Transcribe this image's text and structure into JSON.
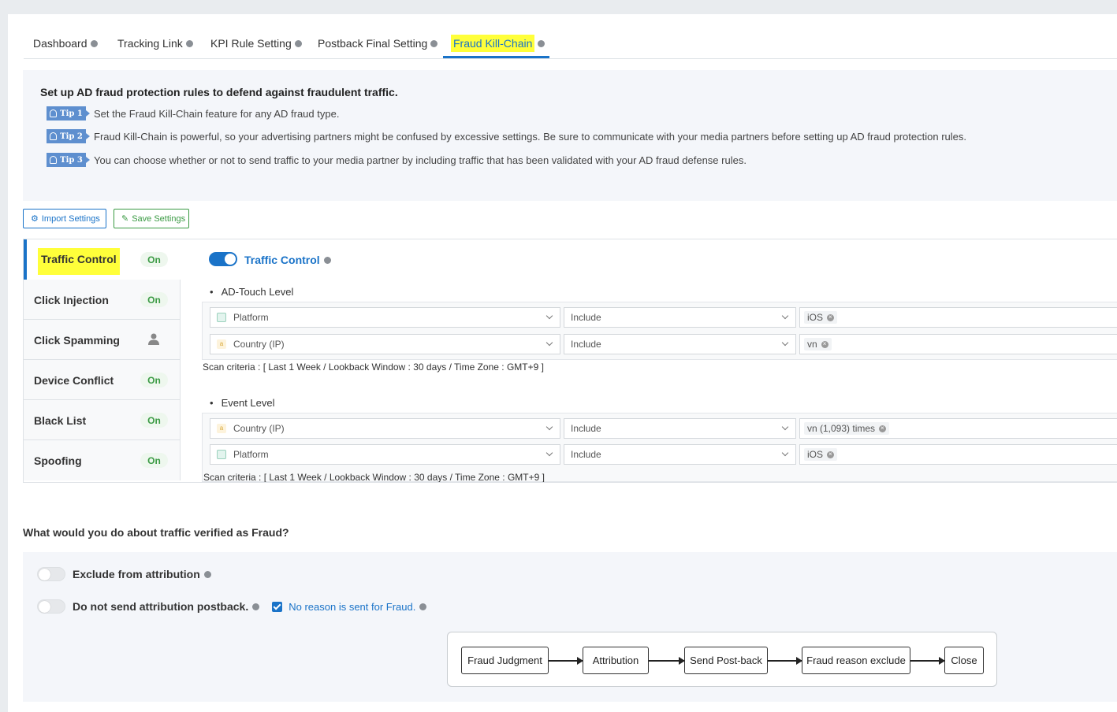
{
  "tabs": [
    {
      "label": "Dashboard"
    },
    {
      "label": "Tracking Link"
    },
    {
      "label": "KPI Rule Setting"
    },
    {
      "label": "Postback Final Setting"
    },
    {
      "label": "Fraud Kill-Chain",
      "active": true
    }
  ],
  "intro": {
    "heading": "Set up AD fraud protection rules to defend against fraudulent traffic.",
    "tips": [
      {
        "badge": "Tip 1",
        "text": "Set the Fraud Kill-Chain feature for any AD fraud type."
      },
      {
        "badge": "Tip 2",
        "text": "Fraud Kill-Chain is powerful, so your advertising partners might be confused by excessive settings. Be sure to communicate with your media partners before setting up AD fraud protection rules."
      },
      {
        "badge": "Tip 3",
        "text": "You can choose whether or not to send traffic to your media partner by including traffic that has been validated with your AD fraud defense rules."
      }
    ]
  },
  "toolbar": {
    "import_label": "Import Settings",
    "save_label": "Save Settings"
  },
  "sidebar": {
    "items": [
      {
        "label": "Traffic Control",
        "status": "On",
        "active": true
      },
      {
        "label": "Click Injection",
        "status": "On"
      },
      {
        "label": "Click Spamming",
        "status": "",
        "icon": "person-icon"
      },
      {
        "label": "Device Conflict",
        "status": "On"
      },
      {
        "label": "Black List",
        "status": "On"
      },
      {
        "label": "Spoofing",
        "status": "On"
      }
    ]
  },
  "rule": {
    "title": "Traffic Control",
    "enabled": true,
    "ad_touch": {
      "label": "AD-Touch Level",
      "rows": [
        {
          "dimension": "Platform",
          "dim_icon": "list-icon",
          "operator": "Include",
          "value": "iOS"
        },
        {
          "dimension": "Country (IP)",
          "dim_icon": "text-icon",
          "operator": "Include",
          "value": "vn"
        }
      ],
      "scan": "Scan criteria : [ Last 1 Week / Lookback Window : 30 days / Time Zone : GMT+9 ]"
    },
    "event": {
      "label": "Event Level",
      "rows": [
        {
          "dimension": "Country (IP)",
          "dim_icon": "text-icon",
          "operator": "Include",
          "value": "vn (1,093) times"
        },
        {
          "dimension": "Platform",
          "dim_icon": "list-icon",
          "operator": "Include",
          "value": "iOS"
        }
      ],
      "scan": "Scan criteria : [ Last 1 Week / Lookback Window : 30 days / Time Zone : GMT+9 ]"
    }
  },
  "fraud_actions": {
    "question": "What would you do about traffic verified as Fraud?",
    "exclude_label": "Exclude from attribution",
    "exclude_enabled": false,
    "postback_label": "Do not send attribution postback.",
    "postback_enabled": false,
    "reason_label": "No reason is sent for Fraud.",
    "reason_checked": true
  },
  "flow": {
    "steps": [
      "Fraud Judgment",
      "Attribution",
      "Send Post-back",
      "Fraud reason exclude",
      "Close"
    ]
  },
  "colors": {
    "accent": "#1a73c8",
    "success": "#3a9a43",
    "highlight": "#ffff3a"
  }
}
